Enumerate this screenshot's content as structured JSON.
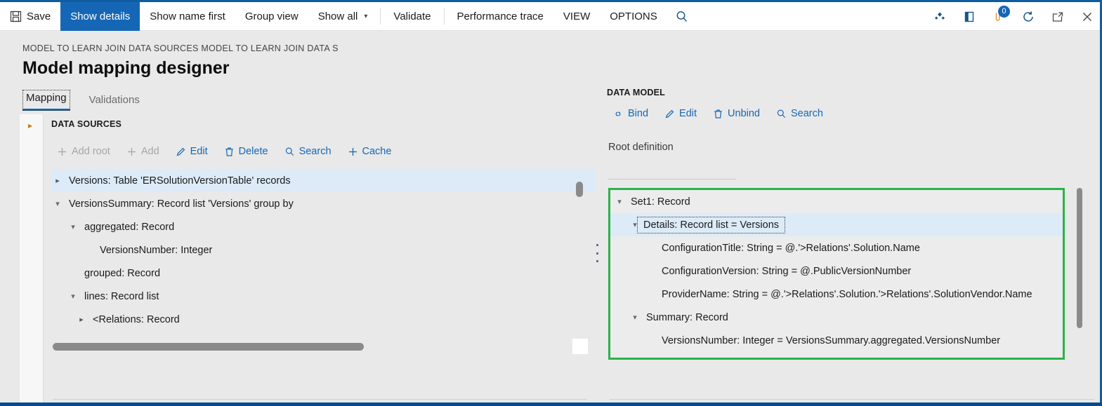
{
  "commandbar": {
    "buttons": [
      {
        "label": "Save",
        "icon": "save-icon",
        "state": "normal"
      },
      {
        "label": "Show details",
        "icon": "",
        "state": "active"
      },
      {
        "label": "Show name first",
        "icon": "",
        "state": "normal"
      },
      {
        "label": "Group view",
        "icon": "",
        "state": "normal"
      },
      {
        "label": "Show all",
        "icon": "chevron-down-icon",
        "state": "normal"
      },
      {
        "label": "Validate",
        "icon": "",
        "state": "normal"
      },
      {
        "label": "Performance trace",
        "icon": "",
        "state": "normal"
      },
      {
        "label": "VIEW",
        "icon": "",
        "state": "normal"
      },
      {
        "label": "OPTIONS",
        "icon": "",
        "state": "normal"
      }
    ],
    "search_icon": "search-icon",
    "right_icons": [
      {
        "name": "diamond-settings-icon"
      },
      {
        "name": "book-icon"
      },
      {
        "name": "annotations-icon",
        "badge": "0"
      },
      {
        "name": "refresh-icon"
      },
      {
        "name": "popout-icon"
      },
      {
        "name": "close-icon"
      }
    ]
  },
  "header": {
    "breadcrumb": "MODEL TO LEARN JOIN DATA SOURCES MODEL TO LEARN JOIN DATA S",
    "title": "Model mapping designer"
  },
  "tabs": [
    {
      "label": "Mapping",
      "selected": true
    },
    {
      "label": "Validations",
      "selected": false
    }
  ],
  "left_pane": {
    "section_label": "DATA SOURCES",
    "collapse_chevron": "chevron-right-icon",
    "toolbar": [
      {
        "label": "Add root",
        "icon": "plus-icon",
        "disabled": true
      },
      {
        "label": "Add",
        "icon": "plus-icon",
        "disabled": true
      },
      {
        "label": "Edit",
        "icon": "pencil-icon",
        "disabled": false
      },
      {
        "label": "Delete",
        "icon": "trash-icon",
        "disabled": false
      },
      {
        "label": "Search",
        "icon": "search-icon",
        "disabled": false
      },
      {
        "label": "Cache",
        "icon": "plus-icon",
        "disabled": false
      }
    ],
    "tree": [
      {
        "label": "Versions: Table 'ERSolutionVersionTable' records",
        "indent": 0,
        "twist": "collapsed",
        "selected": true
      },
      {
        "label": "VersionsSummary: Record list 'Versions' group by",
        "indent": 0,
        "twist": "expanded",
        "selected": false
      },
      {
        "label": "aggregated: Record",
        "indent": 1,
        "twist": "expanded",
        "selected": false
      },
      {
        "label": "VersionsNumber: Integer",
        "indent": 2,
        "twist": "none",
        "selected": false
      },
      {
        "label": "grouped: Record",
        "indent": 1,
        "twist": "none",
        "selected": false
      },
      {
        "label": "lines: Record list",
        "indent": 1,
        "twist": "expanded",
        "selected": false
      },
      {
        "label": "<Relations: Record",
        "indent": 2,
        "twist": "collapsed",
        "selected": false
      }
    ]
  },
  "right_pane": {
    "section_label": "DATA MODEL",
    "toolbar": [
      {
        "label": "Bind",
        "icon": "link-icon",
        "disabled": false
      },
      {
        "label": "Edit",
        "icon": "pencil-icon",
        "disabled": false
      },
      {
        "label": "Unbind",
        "icon": "trash-icon",
        "disabled": false
      },
      {
        "label": "Search",
        "icon": "search-icon",
        "disabled": false
      }
    ],
    "root_definition": "Root definition",
    "tree": [
      {
        "label": "Set1: Record",
        "indent": 0,
        "twist": "expanded",
        "selected": false,
        "focused": false
      },
      {
        "label": "Details: Record list = Versions",
        "indent": 1,
        "twist": "expanded",
        "selected": true,
        "focused": true
      },
      {
        "label": "ConfigurationTitle: String = @.'>Relations'.Solution.Name",
        "indent": 2,
        "twist": "none",
        "selected": false,
        "focused": false
      },
      {
        "label": "ConfigurationVersion: String = @.PublicVersionNumber",
        "indent": 2,
        "twist": "none",
        "selected": false,
        "focused": false
      },
      {
        "label": "ProviderName: String = @.'>Relations'.Solution.'>Relations'.SolutionVendor.Name",
        "indent": 2,
        "twist": "none",
        "selected": false,
        "focused": false
      },
      {
        "label": "Summary: Record",
        "indent": 1,
        "twist": "expanded",
        "selected": false,
        "focused": false
      },
      {
        "label": "VersionsNumber: Integer = VersionsSummary.aggregated.VersionsNumber",
        "indent": 2,
        "twist": "none",
        "selected": false,
        "focused": false
      }
    ]
  },
  "colors": {
    "accent_blue": "#1567b5",
    "top_bar_blue": "#0f5ca0",
    "bottom_bar_blue": "#0a4a8c",
    "highlight_green": "#2bb24c",
    "row_selected": "#dcebf7",
    "pane_background": "#e9e9e9"
  }
}
